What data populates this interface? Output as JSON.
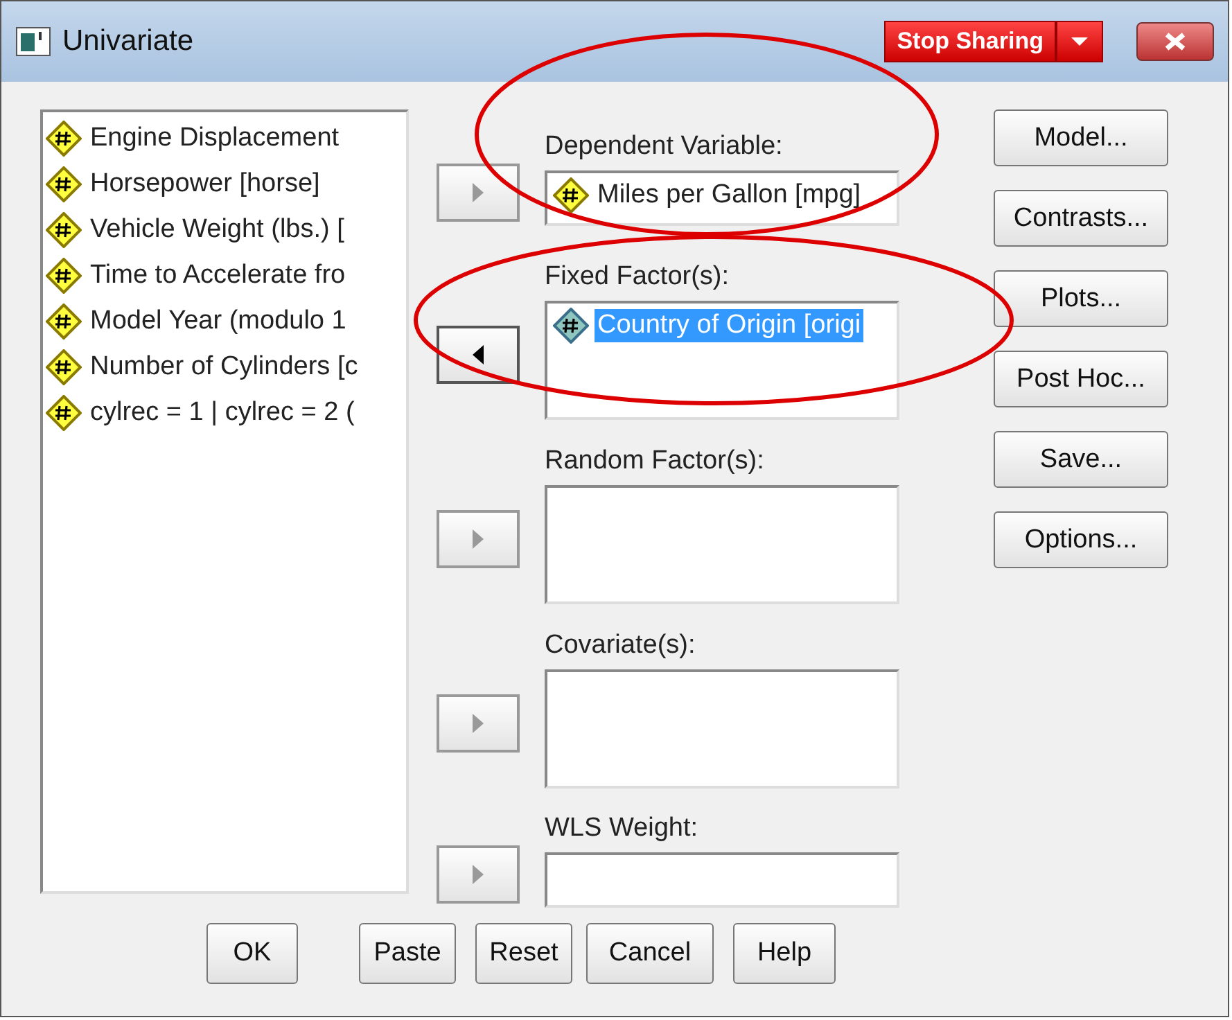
{
  "window": {
    "title": "Univariate",
    "sharing_button": "Stop Sharing"
  },
  "variables": [
    {
      "label": "Engine Displacement",
      "kind": "scale",
      "selected": false
    },
    {
      "label": "Horsepower [horse]",
      "kind": "scale",
      "selected": false
    },
    {
      "label": "Vehicle Weight (lbs.) [",
      "kind": "scale",
      "selected": false
    },
    {
      "label": "Time to Accelerate fro",
      "kind": "scale",
      "selected": false
    },
    {
      "label": "Model Year (modulo 1",
      "kind": "scale",
      "selected": false
    },
    {
      "label": "Number of Cylinders [c",
      "kind": "scale",
      "selected": false
    },
    {
      "label": "cylrec = 1 | cylrec = 2 (",
      "kind": "scale",
      "selected": false
    }
  ],
  "targets": [
    {
      "label": "Dependent Variable:",
      "kind": "single",
      "arrow_left": false,
      "disabled": true,
      "items": [
        {
          "label": "Miles per Gallon [mpg]",
          "kind": "scale",
          "selected": false
        }
      ]
    },
    {
      "label": "Fixed Factor(s):",
      "kind": "list",
      "arrow_left": true,
      "disabled": false,
      "items": [
        {
          "label": "Country of Origin [origi",
          "kind": "nominal",
          "selected": true
        }
      ]
    },
    {
      "label": "Random Factor(s):",
      "kind": "list",
      "arrow_left": false,
      "disabled": true
    },
    {
      "label": "Covariate(s):",
      "kind": "list",
      "arrow_left": false,
      "disabled": true
    },
    {
      "label": "WLS Weight:",
      "kind": "single",
      "arrow_left": false,
      "disabled": true
    }
  ],
  "side_buttons": [
    "Model...",
    "Contrasts...",
    "Plots...",
    "Post Hoc...",
    "Save...",
    "Options..."
  ],
  "bottom_buttons": [
    "OK",
    "Paste",
    "Reset",
    "Cancel",
    "Help"
  ]
}
